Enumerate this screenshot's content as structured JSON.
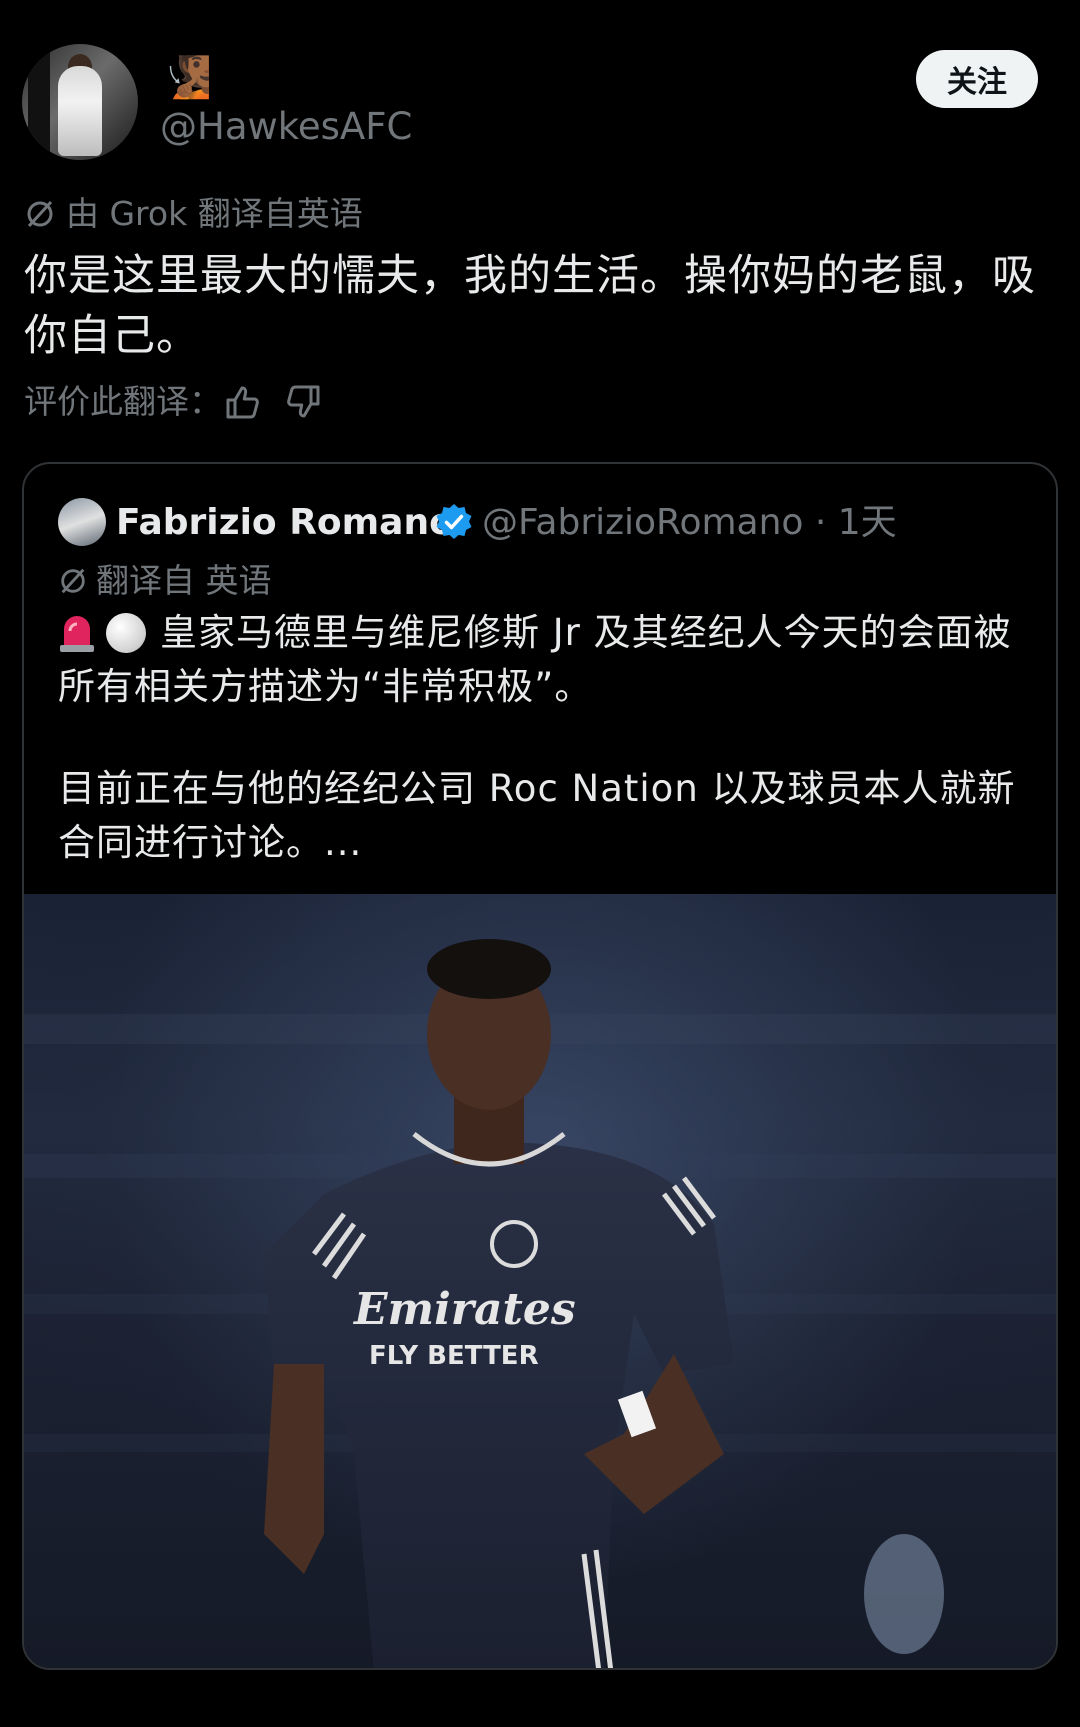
{
  "author": {
    "display_emoji": "🧏🏾",
    "handle": "@HawkesAFC",
    "follow_label": "关注"
  },
  "translation": {
    "source_note": "由 Grok 翻译自英语",
    "text_line1": "你是这里最大的懦夫，我的生活。操你妈的老鼠，吸",
    "text_line2": "你自己。",
    "rate_label": "评价此翻译："
  },
  "quoted_tweet": {
    "name": "Fabrizio Romano",
    "handle_time": "@FabrizioRomano · 1天",
    "translation_note": "翻译自 英语",
    "paragraph1": "皇家马德里与维尼修斯 Jr 及其经纪人今天的会面被所有相关方描述为“非常积极”。",
    "paragraph2": "目前正在与他的经纪公司 Roc Nation 以及球员本人就新合同进行讨论。...",
    "photo_jersey_text1": "Emirates",
    "photo_jersey_text2": "FLY BETTER"
  },
  "colors": {
    "background": "#000000",
    "text_primary": "#e7e9ea",
    "text_secondary": "#71767b",
    "verified_blue": "#1d9bf0",
    "border": "#2f3336"
  },
  "icons": [
    "grok-translate-icon",
    "thumbs-up-icon",
    "thumbs-down-icon",
    "verified-badge-icon",
    "siren-emoji-icon",
    "white-circle-emoji-icon"
  ]
}
